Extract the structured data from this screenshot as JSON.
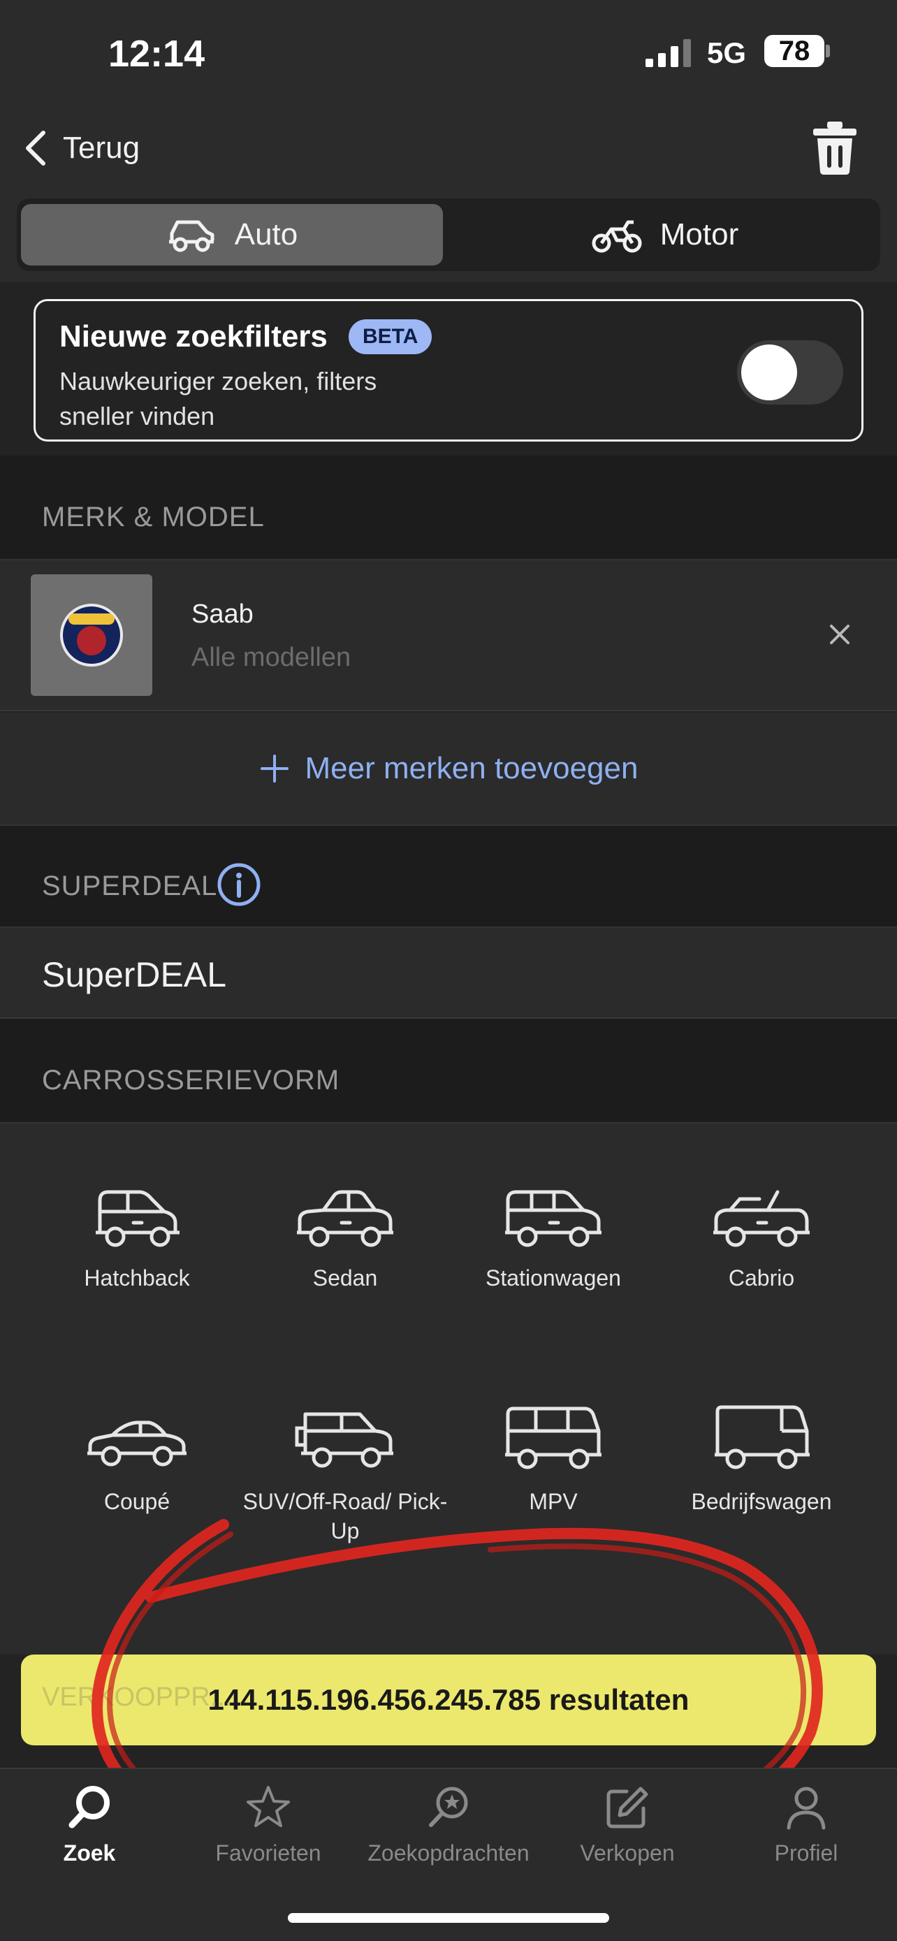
{
  "status": {
    "time": "12:14",
    "network": "5G",
    "battery": "78"
  },
  "nav": {
    "back_label": "Terug"
  },
  "segment": {
    "auto_label": "Auto",
    "motor_label": "Motor"
  },
  "beta_card": {
    "title": "Nieuwe zoekfilters",
    "badge": "BETA",
    "description": "Nauwkeuriger zoeken, filters sneller vinden",
    "toggle_on": false
  },
  "sections": {
    "brand_model": "MERK & MODEL",
    "superdeal": "SUPERDEAL",
    "body_type": "CARROSSERIEVORM"
  },
  "brand": {
    "name": "Saab",
    "models": "Alle modellen",
    "logo_text": "SAAB"
  },
  "add_brands_label": "Meer merken toevoegen",
  "superdeal_label": "SuperDEAL",
  "body_types": [
    {
      "label": "Hatchback",
      "icon": "hatchback-icon"
    },
    {
      "label": "Sedan",
      "icon": "sedan-icon"
    },
    {
      "label": "Stationwagen",
      "icon": "stationwagen-icon"
    },
    {
      "label": "Cabrio",
      "icon": "cabrio-icon"
    },
    {
      "label": "Coupé",
      "icon": "coupe-icon"
    },
    {
      "label": "SUV/Off-Road/ Pick-Up",
      "icon": "suv-icon"
    },
    {
      "label": "MPV",
      "icon": "mpv-icon"
    },
    {
      "label": "Bedrijfswagen",
      "icon": "bedrijfswagen-icon"
    }
  ],
  "hidden_section_partial": "VERKOOPPR...",
  "results_label": "144.115.196.456.245.785 resultaten",
  "tabs": [
    {
      "label": "Zoek",
      "icon": "search-icon",
      "active": true
    },
    {
      "label": "Favorieten",
      "icon": "star-icon",
      "active": false
    },
    {
      "label": "Zoekopdrachten",
      "icon": "saved-search-icon",
      "active": false
    },
    {
      "label": "Verkopen",
      "icon": "edit-icon",
      "active": false
    },
    {
      "label": "Profiel",
      "icon": "profile-icon",
      "active": false
    }
  ],
  "colors": {
    "background": "#232323",
    "accent_blue": "#8fb0f2",
    "results_yellow": "#ece86d",
    "annotation_red": "#e0261f"
  }
}
